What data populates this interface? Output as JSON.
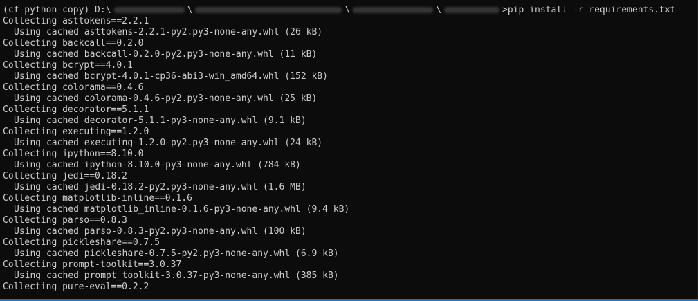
{
  "prompt": {
    "env": "(cf-python-copy) D:\\",
    "sep1": "\\",
    "sep2": "\\",
    "sep3": "\\",
    "command": ">pip install -r requirements.txt"
  },
  "output": [
    {
      "text": "Collecting asttokens==2.2.1",
      "indent": false
    },
    {
      "text": "Using cached asttokens-2.2.1-py2.py3-none-any.whl (26 kB)",
      "indent": true
    },
    {
      "text": "Collecting backcall==0.2.0",
      "indent": false
    },
    {
      "text": "Using cached backcall-0.2.0-py2.py3-none-any.whl (11 kB)",
      "indent": true
    },
    {
      "text": "Collecting bcrypt==4.0.1",
      "indent": false
    },
    {
      "text": "Using cached bcrypt-4.0.1-cp36-abi3-win_amd64.whl (152 kB)",
      "indent": true
    },
    {
      "text": "Collecting colorama==0.4.6",
      "indent": false
    },
    {
      "text": "Using cached colorama-0.4.6-py2.py3-none-any.whl (25 kB)",
      "indent": true
    },
    {
      "text": "Collecting decorator==5.1.1",
      "indent": false
    },
    {
      "text": "Using cached decorator-5.1.1-py3-none-any.whl (9.1 kB)",
      "indent": true
    },
    {
      "text": "Collecting executing==1.2.0",
      "indent": false
    },
    {
      "text": "Using cached executing-1.2.0-py2.py3-none-any.whl (24 kB)",
      "indent": true
    },
    {
      "text": "Collecting ipython==8.10.0",
      "indent": false
    },
    {
      "text": "Using cached ipython-8.10.0-py3-none-any.whl (784 kB)",
      "indent": true
    },
    {
      "text": "Collecting jedi==0.18.2",
      "indent": false
    },
    {
      "text": "Using cached jedi-0.18.2-py2.py3-none-any.whl (1.6 MB)",
      "indent": true
    },
    {
      "text": "Collecting matplotlib-inline==0.1.6",
      "indent": false
    },
    {
      "text": "Using cached matplotlib_inline-0.1.6-py3-none-any.whl (9.4 kB)",
      "indent": true
    },
    {
      "text": "Collecting parso==0.8.3",
      "indent": false
    },
    {
      "text": "Using cached parso-0.8.3-py2.py3-none-any.whl (100 kB)",
      "indent": true
    },
    {
      "text": "Collecting pickleshare==0.7.5",
      "indent": false
    },
    {
      "text": "Using cached pickleshare-0.7.5-py2.py3-none-any.whl (6.9 kB)",
      "indent": true
    },
    {
      "text": "Collecting prompt-toolkit==3.0.37",
      "indent": false
    },
    {
      "text": "Using cached prompt_toolkit-3.0.37-py3-none-any.whl (385 kB)",
      "indent": true
    },
    {
      "text": "Collecting pure-eval==0.2.2",
      "indent": false
    }
  ],
  "colors": {
    "background": "#0c0c0c",
    "foreground": "#cccccc",
    "accent": "#1e6fd0"
  }
}
